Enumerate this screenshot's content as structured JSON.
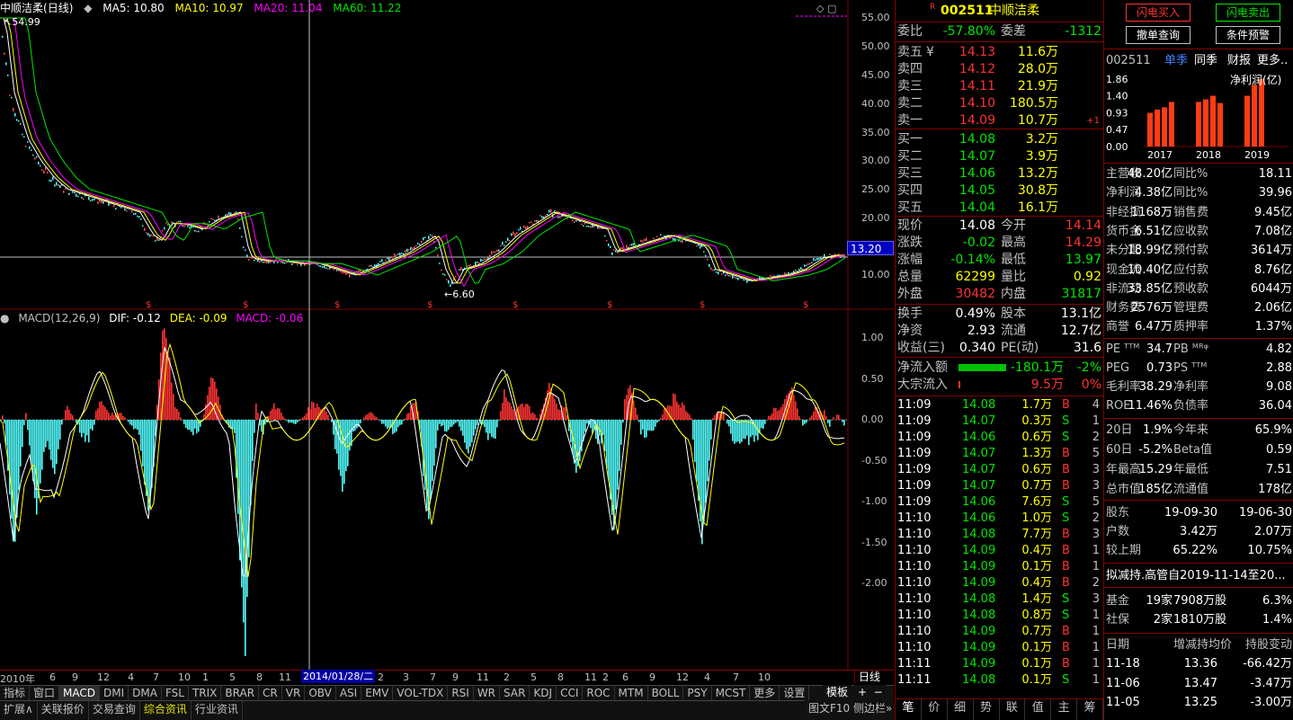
{
  "stock": {
    "code": "002511",
    "name": "中顺洁柔",
    "period": "(日线)",
    "flag": "R"
  },
  "ma": {
    "ma5": "MA5: 10.80",
    "ma10": "MA10: 10.97",
    "ma20": "MA20: 11.04",
    "ma60": "MA60: 11.22"
  },
  "macd": {
    "label": "MACD(12,26,9)",
    "dif": "DIF: -0.12",
    "dea": "DEA: -0.09",
    "macd": "MACD: -0.06"
  },
  "price_axis": [
    "55.00",
    "50.00",
    "45.00",
    "40.00",
    "35.00",
    "30.00",
    "25.00",
    "20.00",
    "15.00",
    "10.00"
  ],
  "macd_axis": [
    "1.00",
    "0.50",
    "0.00",
    "-0.50",
    "-1.00",
    "-1.50",
    "-2.00"
  ],
  "current_price_tag": "13.20",
  "high_marker": "54.99",
  "low_marker": "6.60",
  "crosshair_date": "2014/01/28/二",
  "x_ticks": [
    "2010年",
    "6",
    "9",
    "12",
    "4",
    "7",
    "10",
    "1",
    "5",
    "8",
    "11",
    "2",
    "3",
    "7",
    "9",
    "11",
    "2",
    "5",
    "8",
    "11",
    "2",
    "6",
    "9",
    "12",
    "4",
    "7",
    "10"
  ],
  "period_btn": "日线",
  "indicator_tabs": [
    "指标",
    "窗口",
    "MACD",
    "DMI",
    "DMA",
    "FSL",
    "TRIX",
    "BRAR",
    "CR",
    "VR",
    "OBV",
    "ASI",
    "EMV",
    "VOL-TDX",
    "RSI",
    "WR",
    "SAR",
    "KDJ",
    "CCI",
    "ROC",
    "MTM",
    "BOLL",
    "PSY",
    "MCST",
    "更多",
    "设置"
  ],
  "indicator_right": "模板",
  "bottom_tabs": [
    "扩展∧",
    "关联报价",
    "交易查询",
    "综合资讯",
    "行业资讯"
  ],
  "bottom_right": "图文F10 侧边栏»",
  "quote": {
    "weibi_label": "委比",
    "weibi": "-57.80%",
    "weicha_label": "委差",
    "weicha": "-1312",
    "asks": [
      {
        "label": "卖五",
        "price": "14.13",
        "vol": "11.6万",
        "sym": "¥"
      },
      {
        "label": "卖四",
        "price": "14.12",
        "vol": "28.0万"
      },
      {
        "label": "卖三",
        "price": "14.11",
        "vol": "21.9万"
      },
      {
        "label": "卖二",
        "price": "14.10",
        "vol": "180.5万"
      },
      {
        "label": "卖一",
        "price": "14.09",
        "vol": "10.7万",
        "chg": "+1"
      }
    ],
    "bids": [
      {
        "label": "买一",
        "price": "14.08",
        "vol": "3.2万"
      },
      {
        "label": "买二",
        "price": "14.07",
        "vol": "3.9万"
      },
      {
        "label": "买三",
        "price": "14.06",
        "vol": "13.2万"
      },
      {
        "label": "买四",
        "price": "14.05",
        "vol": "30.8万"
      },
      {
        "label": "买五",
        "price": "14.04",
        "vol": "16.1万"
      }
    ],
    "stats": [
      [
        "现价",
        "14.08",
        "今开",
        "14.14"
      ],
      [
        "涨跌",
        "-0.02",
        "最高",
        "14.29"
      ],
      [
        "涨幅",
        "-0.14%",
        "最低",
        "13.97"
      ],
      [
        "总量",
        "62299",
        "量比",
        "0.92"
      ],
      [
        "外盘",
        "30482",
        "内盘",
        "31817"
      ]
    ],
    "stats2": [
      [
        "换手",
        "0.49%",
        "股本",
        "13.1亿"
      ],
      [
        "净资",
        "2.93",
        "流通",
        "12.7亿"
      ],
      [
        "收益(三)",
        "0.340",
        "PE(动)",
        "31.6"
      ]
    ],
    "flow": [
      {
        "label": "净流入额",
        "value": "-180.1万",
        "pct": "-2%",
        "bar": 0.7
      },
      {
        "label": "大宗流入",
        "value": "9.5万",
        "pct": "0%",
        "bar": 0.02
      }
    ],
    "ticks": [
      [
        "11:09",
        "14.08",
        "1.7万",
        "B",
        "4"
      ],
      [
        "11:09",
        "14.07",
        "0.3万",
        "S",
        "1"
      ],
      [
        "11:09",
        "14.06",
        "0.6万",
        "S",
        "2"
      ],
      [
        "11:09",
        "14.07",
        "1.3万",
        "B",
        "5"
      ],
      [
        "11:09",
        "14.07",
        "0.6万",
        "B",
        "3"
      ],
      [
        "11:09",
        "14.07",
        "0.7万",
        "B",
        "3"
      ],
      [
        "11:09",
        "14.06",
        "7.6万",
        "S",
        "5"
      ],
      [
        "11:10",
        "14.06",
        "1.0万",
        "S",
        "2"
      ],
      [
        "11:10",
        "14.08",
        "7.7万",
        "B",
        "3"
      ],
      [
        "11:10",
        "14.09",
        "0.4万",
        "B",
        "1"
      ],
      [
        "11:10",
        "14.09",
        "0.1万",
        "B",
        "1"
      ],
      [
        "11:10",
        "14.09",
        "0.4万",
        "B",
        "2"
      ],
      [
        "11:10",
        "14.08",
        "1.4万",
        "S",
        "3"
      ],
      [
        "11:10",
        "14.08",
        "0.8万",
        "S",
        "1"
      ],
      [
        "11:10",
        "14.09",
        "0.7万",
        "B",
        "1"
      ],
      [
        "11:10",
        "14.09",
        "0.1万",
        "B",
        "1"
      ],
      [
        "11:11",
        "14.09",
        "0.1万",
        "B",
        "1"
      ],
      [
        "11:11",
        "14.08",
        "0.1万",
        "S",
        "1"
      ]
    ],
    "bottom_tabs": [
      "笔",
      "价",
      "细",
      "势",
      "联",
      "值",
      "主",
      "筹"
    ]
  },
  "right": {
    "buttons": [
      "闪电买入",
      "闪电卖出",
      "撤单查询",
      "条件预警"
    ],
    "tabs": [
      "002511",
      "单季",
      "同季",
      "财报",
      "更多.."
    ],
    "fin_chart": {
      "title": "净利润(亿)",
      "yticks": [
        "1.86",
        "1.40",
        "0.93",
        "0.47",
        "0.00"
      ],
      "years": [
        "2017",
        "2018",
        "2019"
      ],
      "chart_data": {
        "type": "bar",
        "categories": [
          "2017",
          "2018",
          "2019"
        ],
        "series": [
          {
            "values": [
              0.93,
              1.02,
              1.08,
              1.23
            ]
          },
          {
            "values": [
              1.23,
              1.3,
              1.4,
              1.2
            ]
          },
          {
            "values": [
              1.4,
              1.7,
              1.86
            ]
          }
        ],
        "ylim": [
          0,
          1.86
        ]
      }
    },
    "fin": [
      [
        "主营收",
        "48.20亿",
        "同比%",
        "18.11"
      ],
      [
        "净利润",
        "4.38亿",
        "同比%",
        "39.96"
      ],
      [
        "非经损",
        "1168万",
        "销售费",
        "9.45亿"
      ],
      [
        "货币金",
        "6.51亿",
        "应收款",
        "7.08亿"
      ],
      [
        "未分配",
        "18.99亿",
        "预付款",
        "3614万"
      ],
      [
        "现金流",
        "10.40亿",
        "应付款",
        "8.76亿"
      ],
      [
        "非流动",
        "33.85亿",
        "预收款",
        "6044万"
      ],
      [
        "财务费",
        "2576万",
        "管理费",
        "2.06亿"
      ],
      [
        "商誉",
        "6.47万",
        "质押率",
        "1.37%"
      ]
    ],
    "val": [
      [
        "PE ᵀᵀᴹ",
        "34.7",
        "PB ᴹᴿᵠ",
        "4.82"
      ],
      [
        "PEG",
        "0.73",
        "PS ᵀᵀᴹ",
        "2.88"
      ],
      [
        "毛利率",
        "38.29",
        "净利率",
        "9.08"
      ],
      [
        "ROE",
        "11.46%",
        "负债率",
        "36.04"
      ]
    ],
    "perf": [
      [
        "20日",
        "1.9%",
        "今年来",
        "65.9%"
      ],
      [
        "60日",
        "-5.2%",
        "Beta值",
        "0.59"
      ],
      [
        "年最高",
        "15.29",
        "年最低",
        "7.51"
      ],
      [
        "总市值",
        "185亿",
        "流通值",
        "178亿"
      ]
    ],
    "holders": [
      [
        "股东",
        "19-09-30",
        "19-06-30"
      ],
      [
        "户数",
        "3.42万",
        "2.07万"
      ],
      [
        "较上期",
        "65.22%",
        "10.75%"
      ]
    ],
    "notice": "拟减持.高管自2019-11-14至20...",
    "funds": [
      [
        "基金",
        "19家",
        "7908万股",
        "6.3%"
      ],
      [
        "社保",
        "2家",
        "1810万股",
        "1.4%"
      ]
    ],
    "holdtable_header": [
      "日期",
      "增减持均价",
      "持股变动"
    ],
    "holdtable": [
      [
        "11-18",
        "13.36",
        "-66.42万"
      ],
      [
        "11-06",
        "13.47",
        "-3.47万"
      ],
      [
        "11-05",
        "13.25",
        "-3.00万"
      ]
    ]
  }
}
